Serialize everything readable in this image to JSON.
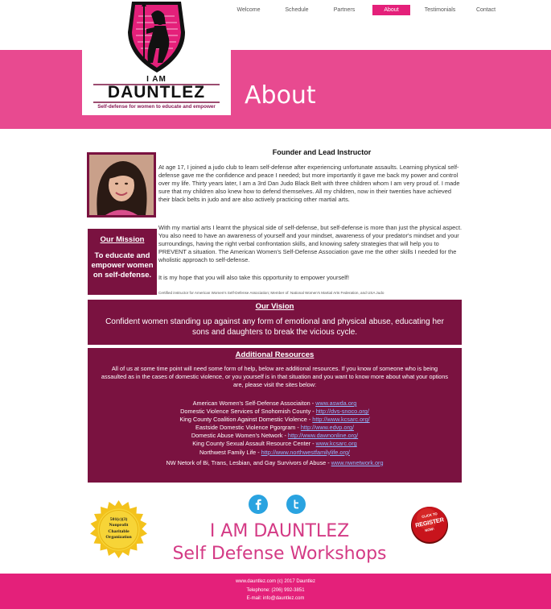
{
  "nav": {
    "items": [
      {
        "label": "Welcome"
      },
      {
        "label": "Schedule"
      },
      {
        "label": "Partners"
      },
      {
        "label": "About"
      },
      {
        "label": "Testimonials"
      },
      {
        "label": "Contact"
      }
    ],
    "active_color": "#e4207a"
  },
  "logo": {
    "line1": "I AM",
    "line2": "DAUNTLEZ",
    "tagline": "Self-defense for women to educate and empower"
  },
  "banner": {
    "heading": "About",
    "color": "#e84a90"
  },
  "founder": {
    "heading": "Founder and Lead Instructor",
    "paragraph1": "At age 17, I joined a judo club to learn self-defense after experiencing unfortunate assaults.  Learning physical self- defense gave me the confidence and peace I needed; but more importantly it gave me back my power and control over my life.   Thirty years later, I am a 3rd Dan Judo Black Belt with three children whom I am very proud of.  I made sure that my children also knew how to defend themselves.  All my children, now in their twenties have achieved their black belts in judo and are also actively practicing other martial arts.",
    "paragraph2": "With my martial arts I learnt the physical side of self-defense, but self-defense is more than just the physical aspect.  You also need to have an awareness of yourself and your mindset, awareness of your predator's mindset and your surroundings, having the right verbal confrontation skills, and knowing safety strategies that will help you to PREVENT a situation.  The American Women's Self-Defense Association gave me the other skills I needed for the wholistic approach to self-defense.",
    "paragraph3": "It is my hope that you will also take this opportunity to empower yourself!",
    "certification": "Certified instructor for American Women's Self-Defense Association; Member of: National Women's Martial Arts Federation, and USA Judo"
  },
  "mission": {
    "title": "Our Mission",
    "text": "To educate and empower women on self-defense."
  },
  "vision": {
    "title": "Our Vision",
    "text": "Confident women standing up against any form of emotional and physical abuse, educating her sons and daughters to break the vicious cycle."
  },
  "resources": {
    "title": "Additional Resources",
    "intro": "All of us at some time point will need some form of help, below are additional resources.  If you know of someone who is being assaulted as in the cases of domestic violence, or you yourself is in that situation and you want to know more about what your options are, please visit the sites below:",
    "items": [
      {
        "name": "American Women's Self-Defense Associaiton - ",
        "link": "www.aswda.org"
      },
      {
        "name": "Domestic Violence Services of Snohomish County - ",
        "link": "http://dvs-snoco.org/"
      },
      {
        "name": "King County Coalition Against Domestic Violence - ",
        "link": "http://www.kcsarc.org/"
      },
      {
        "name": "Eastside Domestic Violence Pgorgram - ",
        "link": "http://www.edvp.org/"
      },
      {
        "name": "Domestic Abuse Women's Network - ",
        "link": "http://www.dawnonline.org/"
      },
      {
        "name": "King County Sexual Assault Resource Center - ",
        "link": "www.kcsarc.org"
      },
      {
        "name": "Northwest Family Life - ",
        "link": "http://www.northwestfamilylife.org/"
      },
      {
        "name": "NW Netork of Bi, Trans, Lesbian, and Gay Survivors of Abuse - ",
        "link": "www.nwnetwork.org"
      }
    ],
    "link_color": "#8fb8ff"
  },
  "social": {
    "facebook_icon": "facebook-icon",
    "twitter_icon": "twitter-icon",
    "color": "#2aa3e0"
  },
  "seal": {
    "line1": "501(c)(3)",
    "line2": "Nonprofit",
    "line3": "Charitable",
    "line4": "Organization"
  },
  "register": {
    "line1": "CLICK TO",
    "line2": "REGISTER",
    "line3": "NOW!"
  },
  "brand": {
    "line1": "I AM DAUNTLEZ",
    "line2": "Self Defense Workshops",
    "color": "#d43a85"
  },
  "footer": {
    "line1": "www.dauntlez.com (c) 2017 Dauntlez",
    "line2": "Telephone:    (206) 992-3851",
    "line3": "E-mail: info@dauntlez.com",
    "color": "#e4207a"
  },
  "panel_color": "#7a1240"
}
